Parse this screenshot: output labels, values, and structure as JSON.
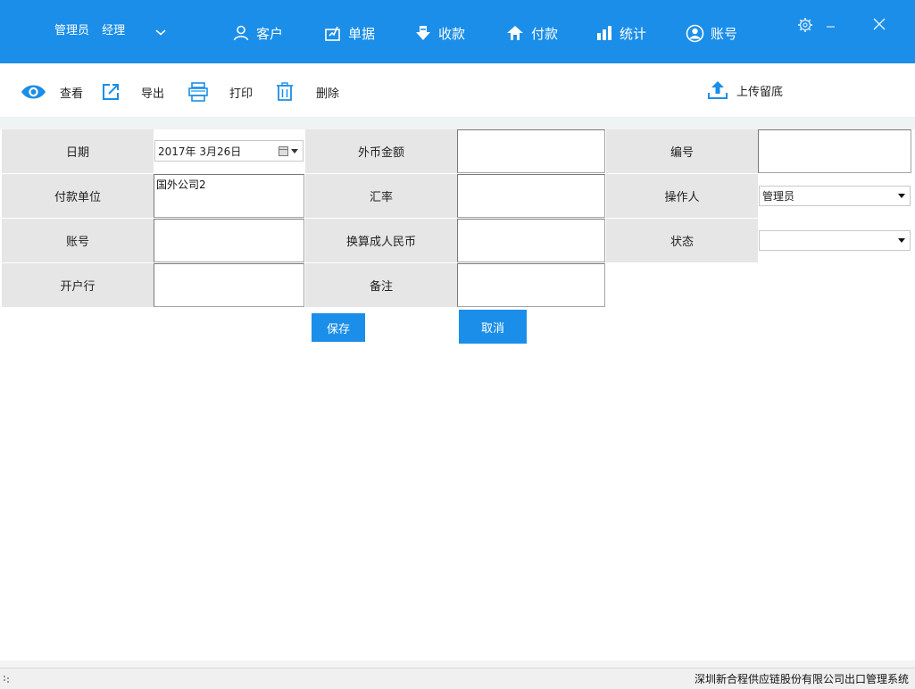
{
  "header": {
    "user_name": "管理员",
    "user_role": "经理",
    "nav": [
      {
        "label": "客户",
        "icon": "user-icon"
      },
      {
        "label": "单据",
        "icon": "document-icon"
      },
      {
        "label": "收款",
        "icon": "download-icon"
      },
      {
        "label": "付款",
        "icon": "upload-home-icon"
      },
      {
        "label": "统计",
        "icon": "bar-chart-icon"
      },
      {
        "label": "账号",
        "icon": "account-icon"
      }
    ]
  },
  "toolbar": {
    "view": "查看",
    "export": "导出",
    "print": "打印",
    "delete": "删除",
    "upload": "上传留底"
  },
  "form": {
    "date_label": "日期",
    "date_value": "2017年  3月26日",
    "foreign_amount_label": "外币金额",
    "foreign_amount_value": "",
    "number_label": "编号",
    "number_value": "",
    "payee_label": "付款单位",
    "payee_value": "国外公司2",
    "rate_label": "汇率",
    "rate_value": "",
    "operator_label": "操作人",
    "operator_value": "管理员",
    "account_label": "账号",
    "account_value": "",
    "rmb_label": "换算成人民币",
    "rmb_value": "",
    "status_label": "状态",
    "status_value": "",
    "bank_label": "开户行",
    "bank_value": "",
    "remark_label": "备注",
    "remark_value": ""
  },
  "buttons": {
    "save": "保存",
    "cancel": "取消"
  },
  "status": {
    "company": "深圳新合程供应链股份有限公司出口管理系统"
  },
  "colors": {
    "accent": "#1a8ee8",
    "label_bg": "#e6e6e6"
  }
}
